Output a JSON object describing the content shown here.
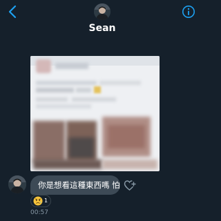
{
  "header": {
    "contact_name": "Sean",
    "icons": {
      "back": "chevron-left-icon",
      "info": "info-circle-icon"
    }
  },
  "message": {
    "text": "你是想看這種東西嗎 怕",
    "reaction": {
      "emoji": "worried-face-emoji",
      "count": "1"
    },
    "timestamp": "00:57"
  },
  "colors": {
    "background": "#15202b",
    "accent": "#1da1f2",
    "bubble": "#3d4a56",
    "secondary_text": "#8899a6"
  }
}
